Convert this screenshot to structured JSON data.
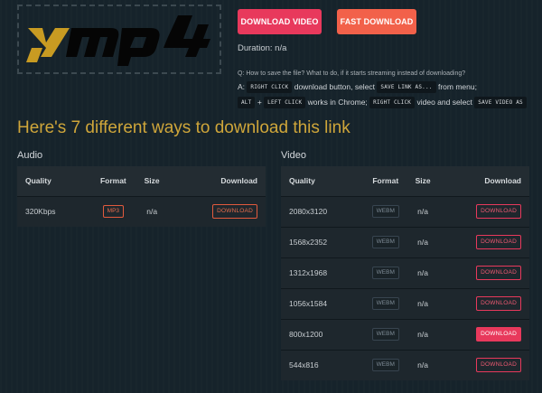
{
  "logo": {
    "text": "ymp4",
    "alt": "ymp4"
  },
  "buttons": {
    "download_video": "DOWNLOAD VIDEO",
    "fast_download": "FAST DOWNLOAD"
  },
  "duration": "Duration: n/a",
  "faq": {
    "question": "Q: How to save the file? What to do, if it starts streaming instead of downloading?",
    "answer_prefix": "A:",
    "kbd_right_click": "RIGHT CLICK",
    "text_download_button": "download button, select",
    "kbd_save_link": "SAVE LINK AS...",
    "text_from_menu": "from menu;",
    "kbd_alt": "ALT",
    "text_plus": "+",
    "kbd_left_click": "LEFT CLICK",
    "text_works_chrome": "works in Chrome;",
    "kbd_right_click_2": "RIGHT CLICK",
    "text_video_select": "video and select",
    "kbd_save_video": "SAVE VIDEO AS"
  },
  "heading": "Here's 7 different ways to download this link",
  "audio": {
    "label": "Audio",
    "columns": {
      "quality": "Quality",
      "format": "Format",
      "size": "Size",
      "download": "Download"
    },
    "rows": [
      {
        "quality": "320Kbps",
        "format": "MP3",
        "size": "n/a",
        "download": "DOWNLOAD"
      }
    ]
  },
  "video": {
    "label": "Video",
    "columns": {
      "quality": "Quality",
      "format": "Format",
      "size": "Size",
      "download": "Download"
    },
    "rows": [
      {
        "quality": "2080x3120",
        "format": "WEBM",
        "size": "n/a",
        "download": "DOWNLOAD"
      },
      {
        "quality": "1568x2352",
        "format": "WEBM",
        "size": "n/a",
        "download": "DOWNLOAD"
      },
      {
        "quality": "1312x1968",
        "format": "WEBM",
        "size": "n/a",
        "download": "DOWNLOAD"
      },
      {
        "quality": "1056x1584",
        "format": "WEBM",
        "size": "n/a",
        "download": "DOWNLOAD"
      },
      {
        "quality": "800x1200",
        "format": "WEBM",
        "size": "n/a",
        "download": "DOWNLOAD"
      },
      {
        "quality": "544x816",
        "format": "WEBM",
        "size": "n/a",
        "download": "DOWNLOAD"
      }
    ]
  },
  "colors": {
    "background": "#16232b",
    "accent_pink": "#e8395c",
    "accent_orange": "#f2614a",
    "heading_gold": "#cfa63a"
  }
}
